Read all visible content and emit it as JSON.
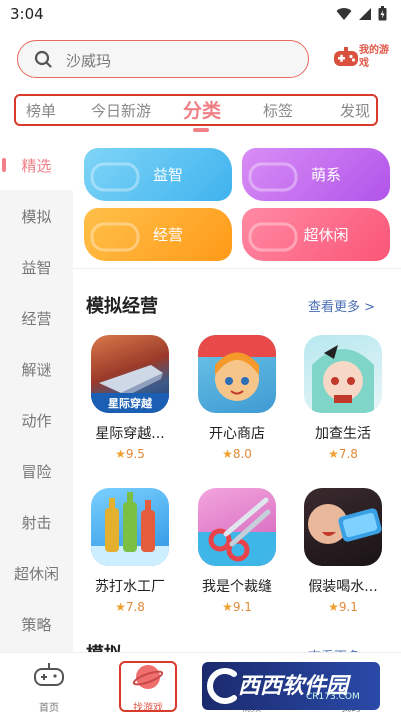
{
  "status_bar": {
    "time": "3:04"
  },
  "search": {
    "placeholder": "沙威玛"
  },
  "my_games": {
    "label": "我的游戏"
  },
  "tabs": [
    {
      "label": "榜单",
      "active": false
    },
    {
      "label": "今日新游",
      "active": false
    },
    {
      "label": "分类",
      "active": true
    },
    {
      "label": "标签",
      "active": false
    },
    {
      "label": "发现",
      "active": false
    }
  ],
  "sidebar": {
    "items": [
      {
        "label": "精选",
        "active": true
      },
      {
        "label": "模拟"
      },
      {
        "label": "益智"
      },
      {
        "label": "经营"
      },
      {
        "label": "解谜"
      },
      {
        "label": "动作"
      },
      {
        "label": "冒险"
      },
      {
        "label": "射击"
      },
      {
        "label": "超休闲"
      },
      {
        "label": "策略"
      }
    ]
  },
  "categories": [
    {
      "label": "益智",
      "color": "#5bc4f2"
    },
    {
      "label": "萌系",
      "color": "#c86cf0"
    },
    {
      "label": "经营",
      "color": "#ffaa2b"
    },
    {
      "label": "超休闲",
      "color": "#ff6a8a"
    }
  ],
  "section": {
    "title": "模拟经营",
    "see_more": "查看更多 >",
    "games": [
      {
        "name": "星际穿越...",
        "rating": "9.5",
        "icon": "space-game-icon",
        "badge": "星际穿越"
      },
      {
        "name": "开心商店",
        "rating": "8.0",
        "icon": "happy-shop-icon"
      },
      {
        "name": "加查生活",
        "rating": "7.8",
        "icon": "gacha-life-icon"
      },
      {
        "name": "苏打水工厂",
        "rating": "7.8",
        "icon": "soda-factory-icon"
      },
      {
        "name": "我是个裁缝",
        "rating": "9.1",
        "icon": "tailor-icon"
      },
      {
        "name": "假装喝水...",
        "rating": "9.1",
        "icon": "drink-water-icon"
      }
    ]
  },
  "section2": {
    "title": "模拟",
    "see_more": "查看更多"
  },
  "bottom_nav": [
    {
      "label": "首页"
    },
    {
      "label": "找游戏",
      "active": true
    },
    {
      "label": "视频"
    },
    {
      "label": "我的"
    }
  ],
  "watermark": {
    "text": "西西软件园",
    "sub": "CR173.COM"
  },
  "colors": {
    "accent": "#f07f86",
    "highlight_border": "#d93a2b",
    "link": "#4a6fb5"
  }
}
